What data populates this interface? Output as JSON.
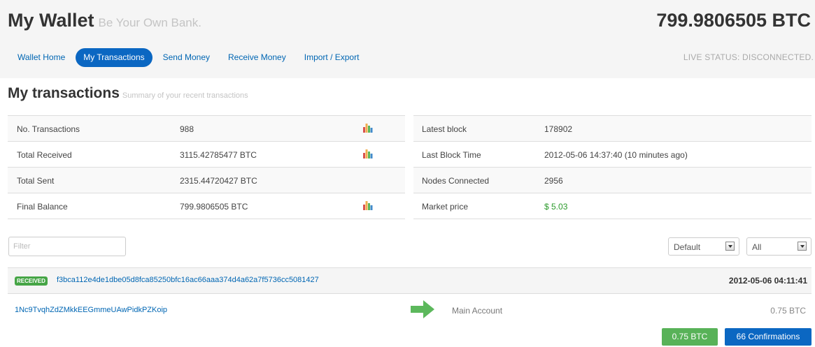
{
  "header": {
    "title": "My Wallet",
    "tagline": "Be Your Own Bank.",
    "balance": "799.9806505 BTC",
    "live_status": "LIVE STATUS: DISCONNECTED."
  },
  "nav": {
    "items": [
      {
        "label": "Wallet Home",
        "active": false
      },
      {
        "label": "My Transactions",
        "active": true
      },
      {
        "label": "Send Money",
        "active": false
      },
      {
        "label": "Receive Money",
        "active": false
      },
      {
        "label": "Import / Export",
        "active": false
      }
    ]
  },
  "section": {
    "title": "My transactions",
    "subtitle": "Summary of your recent transactions"
  },
  "summary": {
    "left": [
      {
        "label": "No. Transactions",
        "value": "988",
        "chart_icon": true
      },
      {
        "label": "Total Received",
        "value": "3115.42785477 BTC",
        "chart_icon": true
      },
      {
        "label": "Total Sent",
        "value": "2315.44720427 BTC",
        "chart_icon": false
      },
      {
        "label": "Final Balance",
        "value": "799.9806505 BTC",
        "chart_icon": true
      }
    ],
    "right": [
      {
        "label": "Latest block",
        "value": "178902"
      },
      {
        "label": "Last Block Time",
        "value": "2012-05-06 14:37:40 (10 minutes ago)"
      },
      {
        "label": "Nodes Connected",
        "value": "2956"
      },
      {
        "label": "Market price",
        "value": "$ 5.03"
      }
    ]
  },
  "filters": {
    "filter_placeholder": "Filter",
    "sort_selected": "Default",
    "type_selected": "All"
  },
  "transaction": {
    "badge": "RECEIVED",
    "hash": "f3bca112e4de1dbe05d8fca85250bfc16ac66aaa374d4a62a7f5736cc5081427",
    "date": "2012-05-06 04:11:41",
    "from_address": "1Nc9TvqhZdZMkkEEGmmeUAwPidkPZKoip",
    "to_account": "Main Account",
    "amount": "0.75 BTC",
    "amount_button": "0.75 BTC",
    "confirmations_button": "66 Confirmations"
  },
  "colors": {
    "accent": "#0b67c2",
    "received_green": "#46a546",
    "price_green": "#2a9a2a"
  }
}
